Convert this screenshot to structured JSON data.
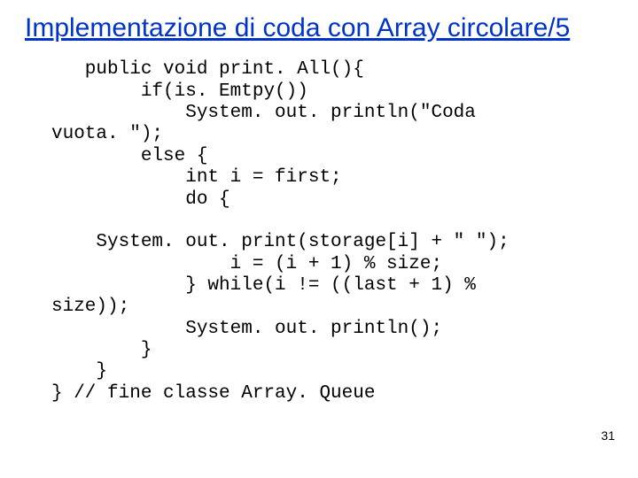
{
  "title": "Implementazione di coda con Array circolare/5",
  "code": "   public void print. All(){\n        if(is. Emtpy())\n            System. out. println(\"Coda\nvuota. \");\n        else {\n            int i = first;\n            do {\n\n    System. out. print(storage[i] + \" \");\n                i = (i + 1) % size;\n            } while(i != ((last + 1) %\nsize));\n            System. out. println();\n        }\n    }\n} // fine classe Array. Queue",
  "page_number": "31"
}
